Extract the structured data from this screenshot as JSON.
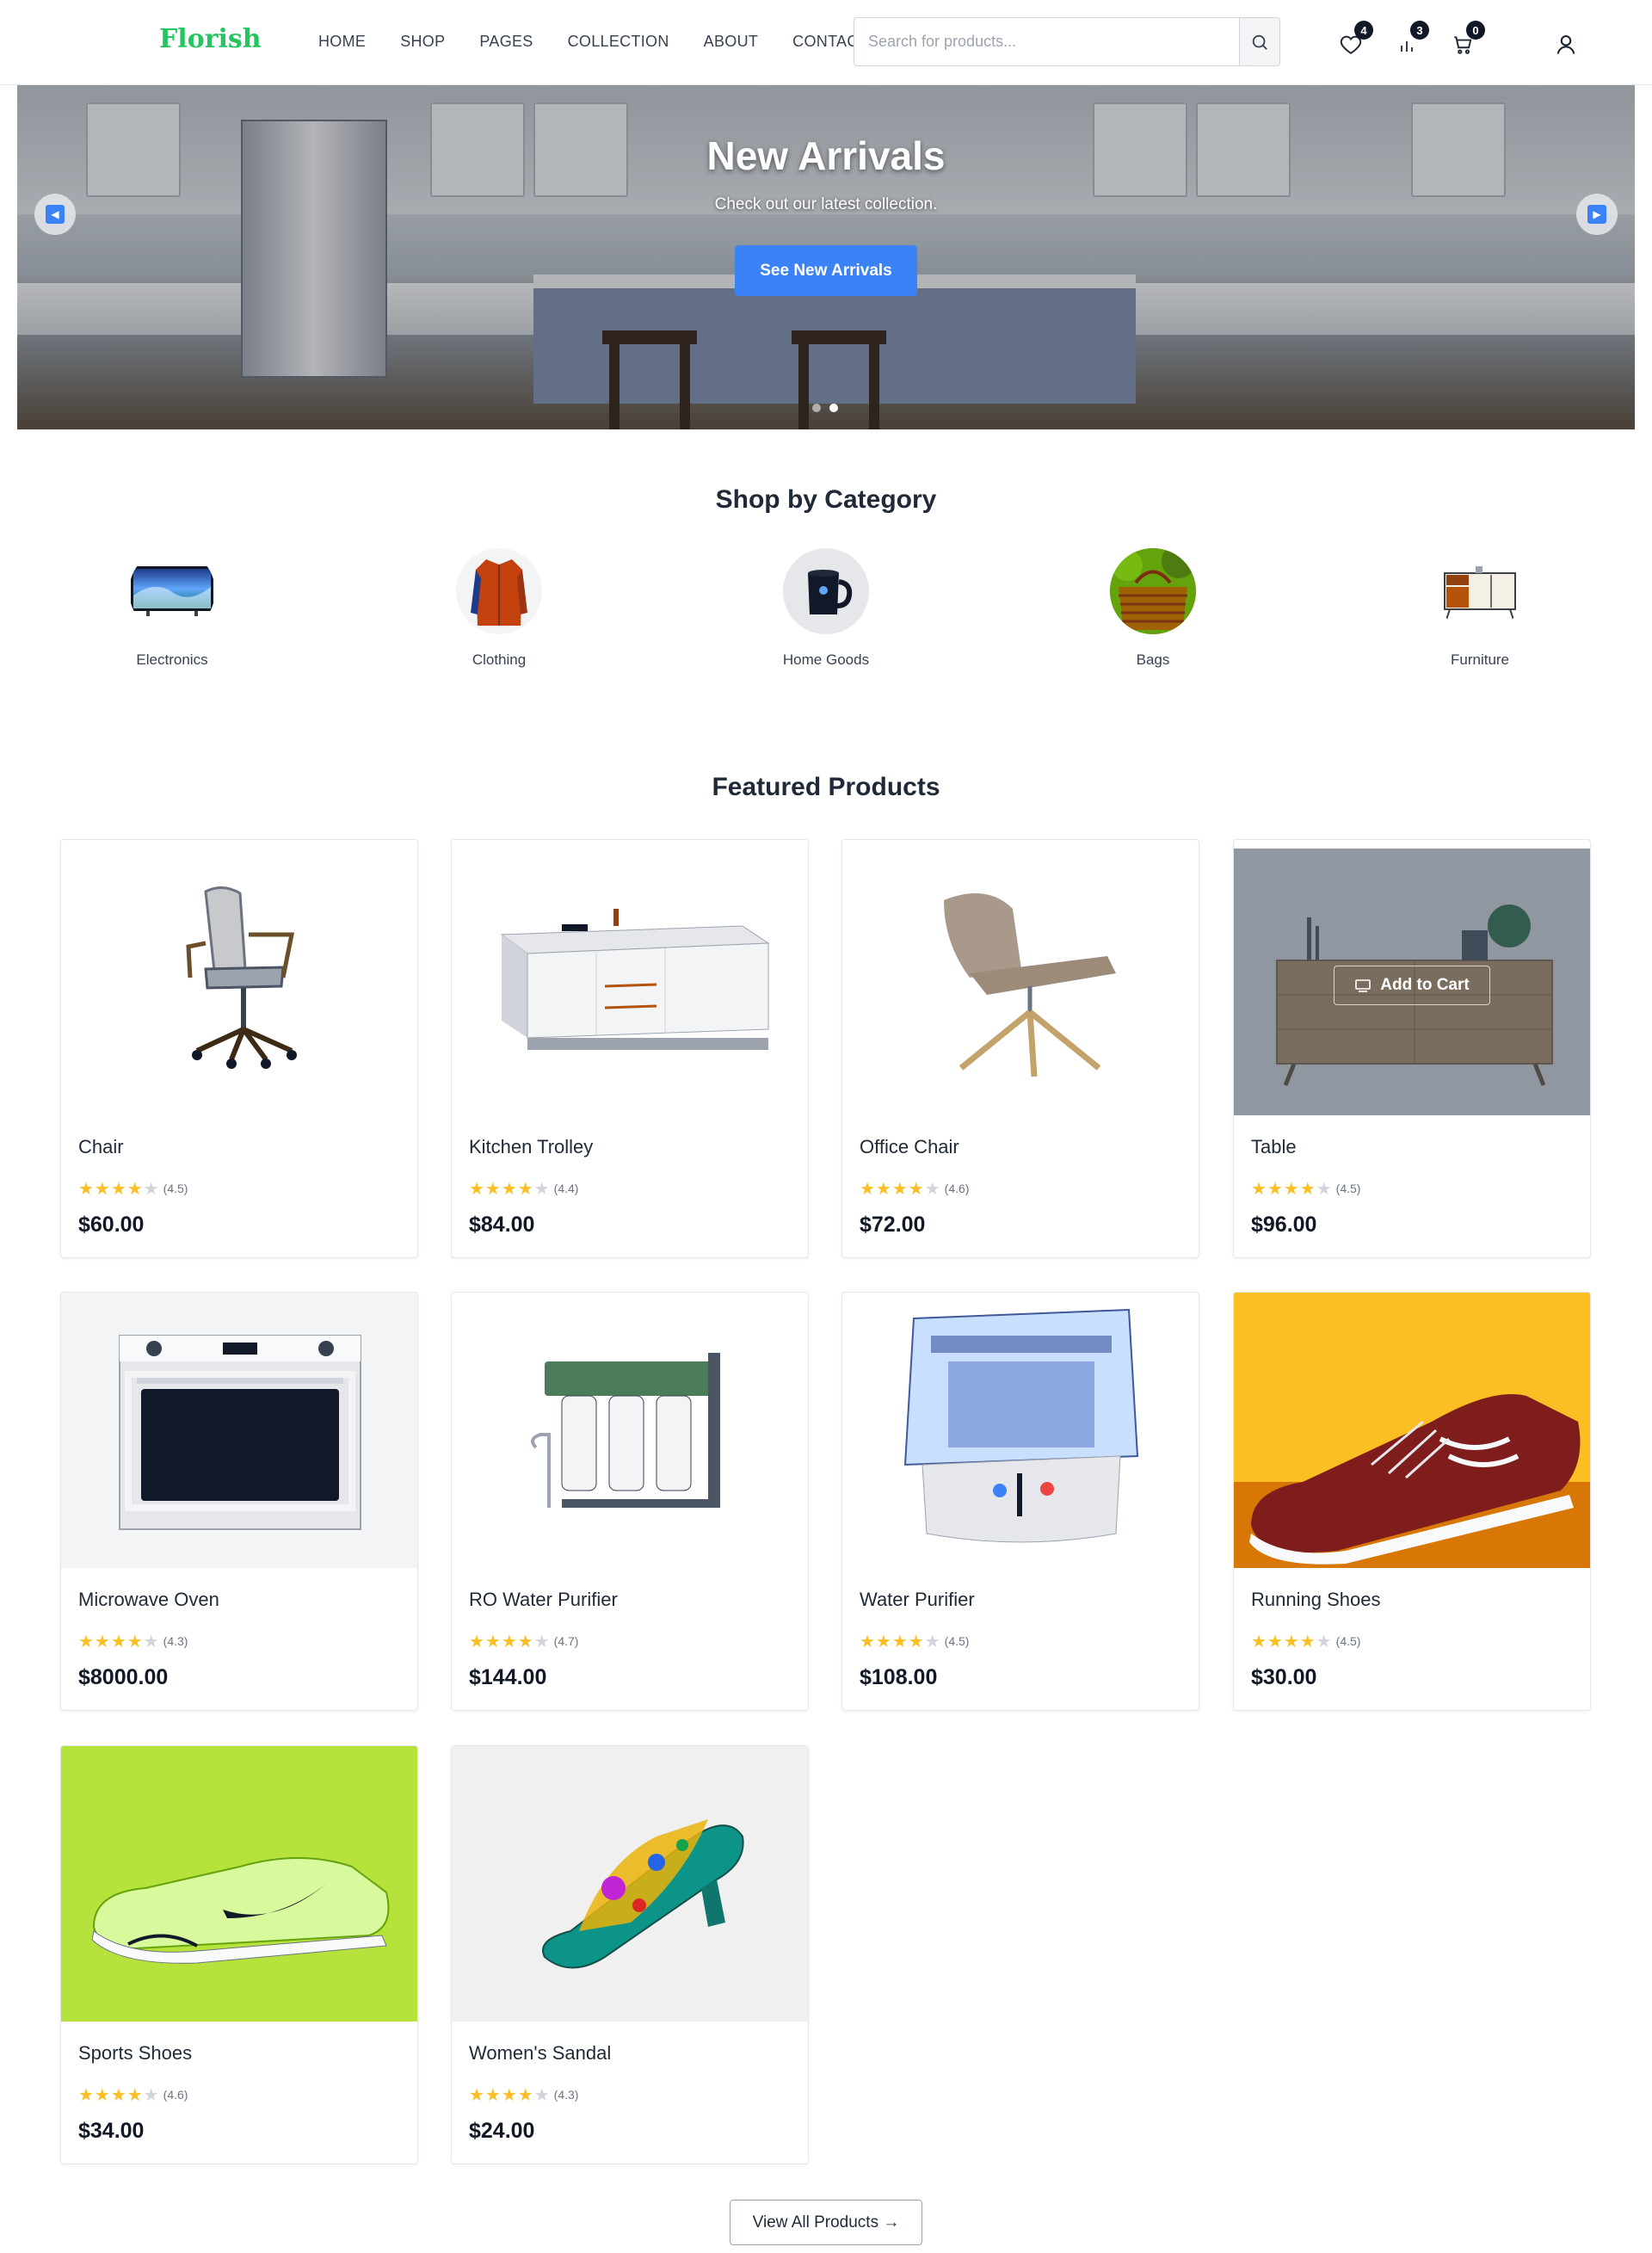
{
  "header": {
    "logo": "Florish",
    "nav": [
      "HOME",
      "SHOP",
      "PAGES",
      "COLLECTION",
      "ABOUT",
      "CONTACT"
    ],
    "search_placeholder": "Search for products...",
    "wishlist_count": "4",
    "compare_count": "3",
    "cart_count": "0"
  },
  "hero": {
    "title": "New Arrivals",
    "subtitle": "Check out our latest collection.",
    "button": "See New Arrivals",
    "slides": 2,
    "active_slide": 2
  },
  "categories": {
    "title": "Shop by Category",
    "items": [
      {
        "label": "Electronics",
        "icon": "tv-icon"
      },
      {
        "label": "Clothing",
        "icon": "jacket-icon"
      },
      {
        "label": "Home Goods",
        "icon": "mug-icon"
      },
      {
        "label": "Bags",
        "icon": "basket-icon"
      },
      {
        "label": "Furniture",
        "icon": "sideboard-icon"
      }
    ]
  },
  "featured": {
    "title": "Featured Products",
    "add_to_cart": "Add to Cart",
    "products": [
      {
        "name": "Chair",
        "rating": "(4.5)",
        "stars": 4,
        "price": "$60.00"
      },
      {
        "name": "Kitchen Trolley",
        "rating": "(4.4)",
        "stars": 4,
        "price": "$84.00"
      },
      {
        "name": "Office Chair",
        "rating": "(4.6)",
        "stars": 4,
        "price": "$72.00"
      },
      {
        "name": "Table",
        "rating": "(4.5)",
        "stars": 4,
        "price": "$96.00"
      },
      {
        "name": "Microwave Oven",
        "rating": "(4.3)",
        "stars": 4,
        "price": "$8000.00"
      },
      {
        "name": "RO Water Purifier",
        "rating": "(4.7)",
        "stars": 4,
        "price": "$144.00"
      },
      {
        "name": "Water Purifier",
        "rating": "(4.5)",
        "stars": 4,
        "price": "$108.00"
      },
      {
        "name": "Running Shoes",
        "rating": "(4.5)",
        "stars": 4,
        "price": "$30.00"
      },
      {
        "name": "Sports Shoes",
        "rating": "(4.6)",
        "stars": 4,
        "price": "$34.00"
      },
      {
        "name": "Women's Sandal",
        "rating": "(4.3)",
        "stars": 4,
        "price": "$24.00"
      }
    ],
    "view_all": "View All Products →"
  },
  "colors": {
    "brand": "#22c55e",
    "accent": "#3b82f6",
    "star": "#fbbf24"
  }
}
